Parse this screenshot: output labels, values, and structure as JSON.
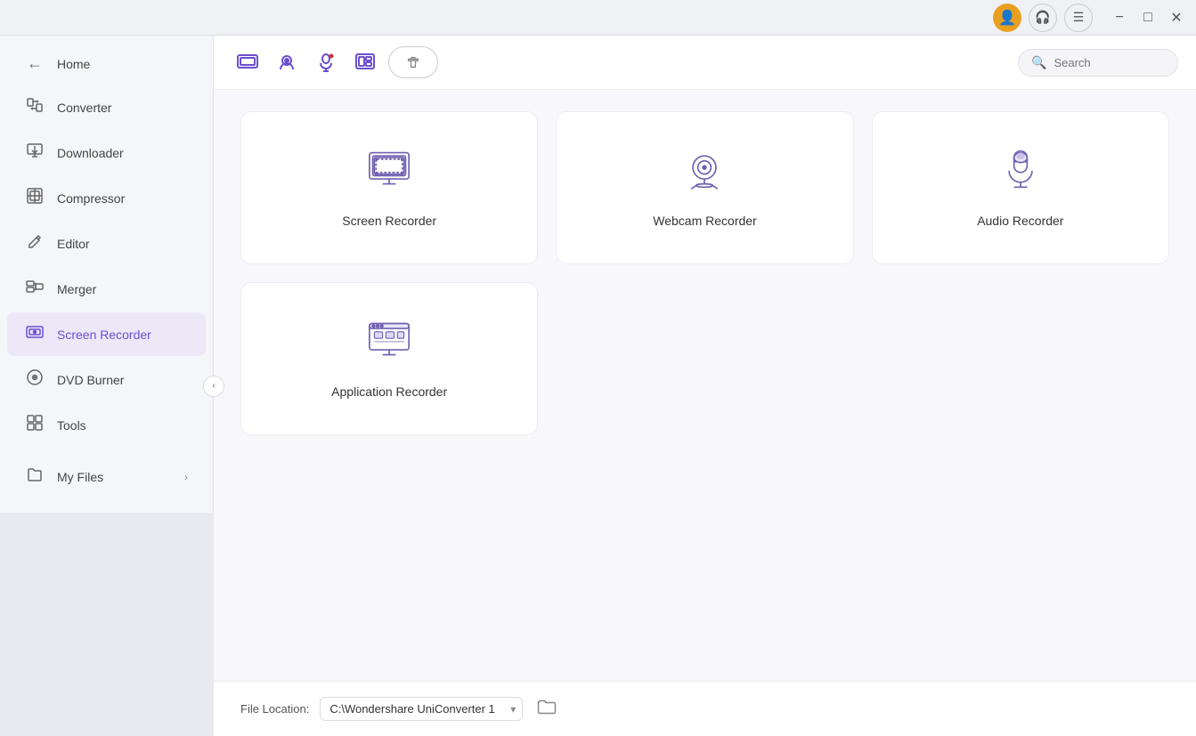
{
  "titlebar": {
    "user_icon": "👤",
    "headphone_icon": "🎧",
    "menu_icon": "☰",
    "minimize_label": "−",
    "maximize_label": "□",
    "close_label": "✕"
  },
  "sidebar": {
    "home_label": "Home",
    "items": [
      {
        "id": "converter",
        "label": "Converter",
        "icon": "⊞"
      },
      {
        "id": "downloader",
        "label": "Downloader",
        "icon": "⊡"
      },
      {
        "id": "compressor",
        "label": "Compressor",
        "icon": "▤"
      },
      {
        "id": "editor",
        "label": "Editor",
        "icon": "✂"
      },
      {
        "id": "merger",
        "label": "Merger",
        "icon": "⊟"
      },
      {
        "id": "screen-recorder",
        "label": "Screen Recorder",
        "icon": "◫",
        "active": true
      },
      {
        "id": "dvd-burner",
        "label": "DVD Burner",
        "icon": "⊙"
      },
      {
        "id": "tools",
        "label": "Tools",
        "icon": "⊞"
      }
    ],
    "my_files_label": "My Files"
  },
  "toolbar": {
    "btn1_icon": "◻",
    "btn2_icon": "◉",
    "btn3_icon": "🎙",
    "btn4_icon": "⊞",
    "trash_icon": "🗑",
    "search_placeholder": "Search"
  },
  "cards": [
    {
      "id": "screen-recorder",
      "label": "Screen Recorder"
    },
    {
      "id": "webcam-recorder",
      "label": "Webcam Recorder"
    },
    {
      "id": "audio-recorder",
      "label": "Audio Recorder"
    },
    {
      "id": "application-recorder",
      "label": "Application Recorder"
    }
  ],
  "file_location": {
    "label": "File Location:",
    "path": "C:\\Wondershare UniConverter 1",
    "folder_icon": "📁"
  }
}
